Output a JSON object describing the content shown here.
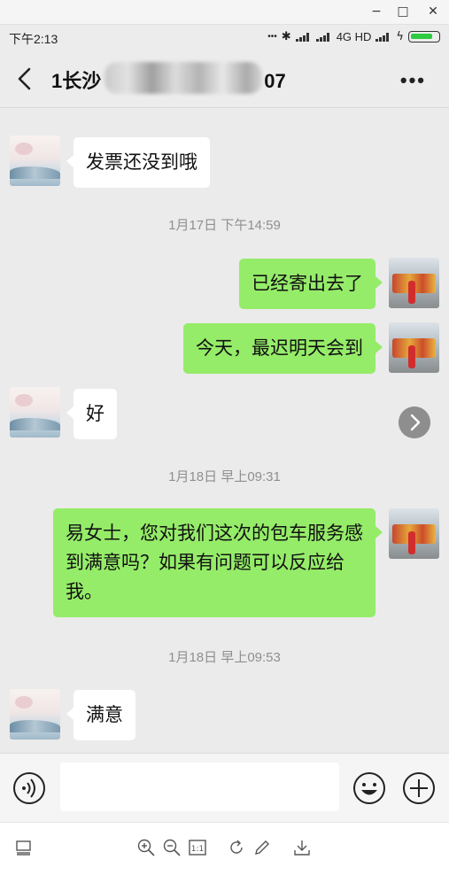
{
  "window": {
    "minimize": "−",
    "maximize": "□",
    "close": "✕"
  },
  "status_bar": {
    "time": "下午2:13",
    "dots": "•••",
    "network": "4G HD"
  },
  "header": {
    "title_prefix": "1长沙",
    "title_suffix": "07",
    "more": "•••"
  },
  "messages": [
    {
      "side": "left",
      "text": "发票还没到哦"
    },
    {
      "timestamp": "1月17日 下午14:59"
    },
    {
      "side": "right",
      "text": "已经寄出去了"
    },
    {
      "side": "right",
      "text": "今天，最迟明天会到"
    },
    {
      "side": "left",
      "text": "好"
    },
    {
      "timestamp": "1月18日 早上09:31"
    },
    {
      "side": "right",
      "text": "易女士，您对我们这次的包车服务感到满意吗？如果有问题可以反应给我。"
    },
    {
      "timestamp": "1月18日 早上09:53"
    },
    {
      "side": "left",
      "text": "满意"
    }
  ],
  "input": {
    "value": ""
  },
  "colors": {
    "chat_bg": "#ebebeb",
    "bubble_right": "#95ec69",
    "bubble_left": "#ffffff",
    "timestamp": "#8f8f8f"
  },
  "icons": [
    "back-arrow-icon",
    "more-dots-icon",
    "voice-icon",
    "emoji-icon",
    "plus-icon",
    "forward-arrow-icon",
    "zoom-in-icon",
    "zoom-out-icon",
    "actual-size-icon",
    "rotate-icon",
    "edit-icon",
    "download-icon",
    "fit-icon"
  ]
}
